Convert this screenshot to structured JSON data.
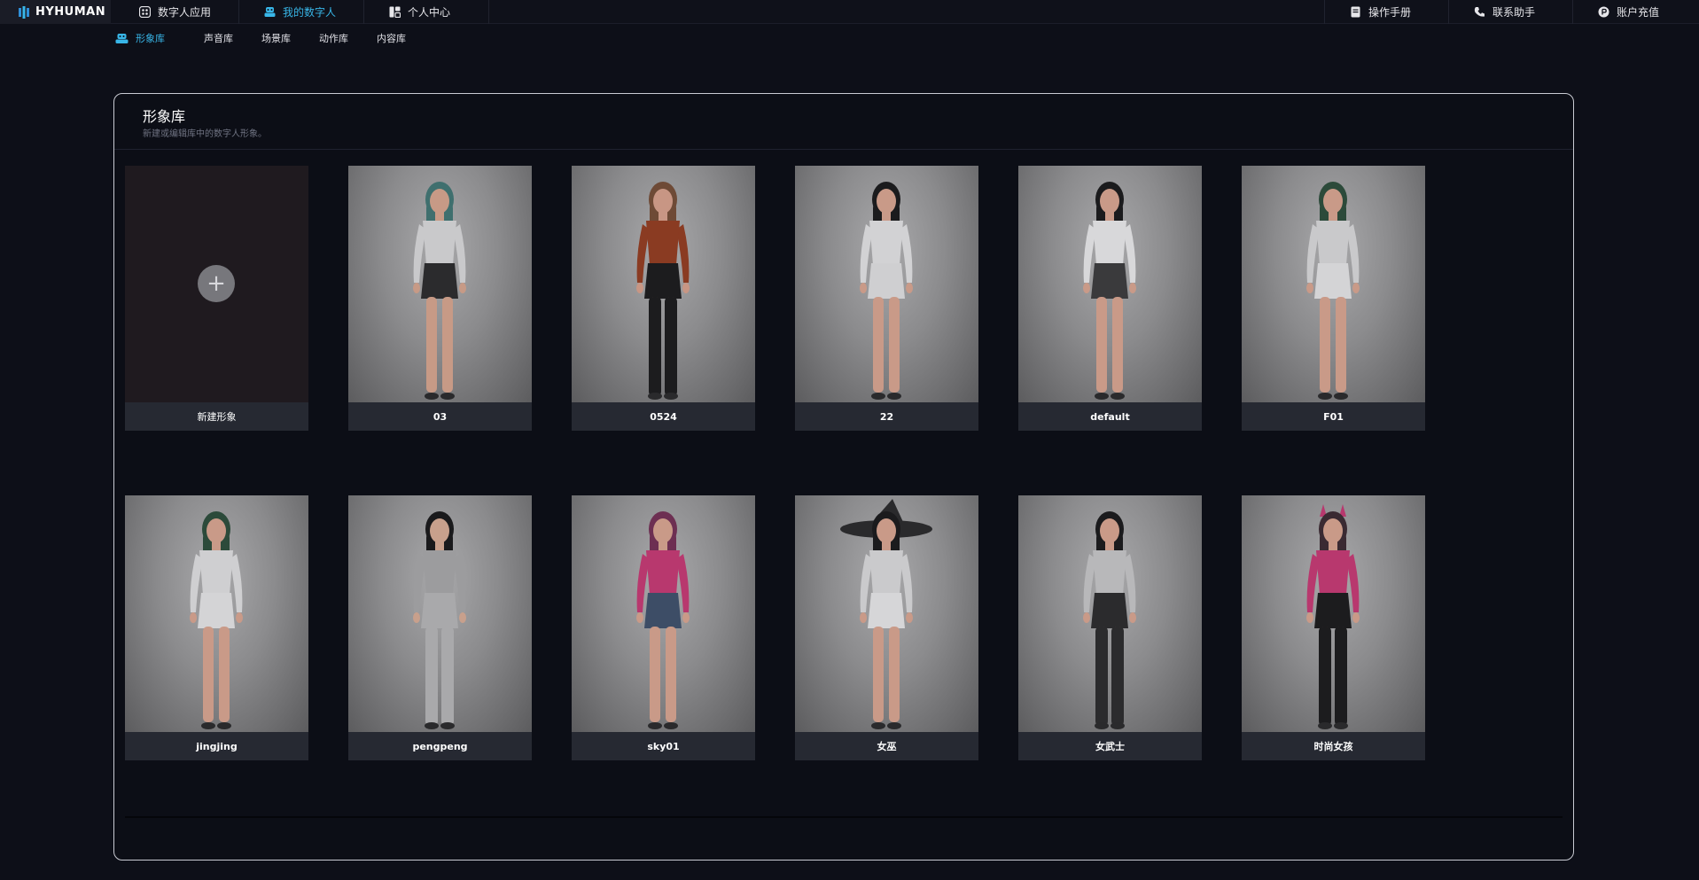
{
  "brand": {
    "name": "HYHUMAN"
  },
  "top_nav": {
    "left": [
      {
        "label": "数字人应用",
        "icon": "apps-icon"
      },
      {
        "label": "我的数字人",
        "icon": "avatar-icon",
        "active": true
      },
      {
        "label": "个人中心",
        "icon": "user-center-icon"
      }
    ],
    "right": [
      {
        "label": "操作手册",
        "icon": "manual-icon"
      },
      {
        "label": "联系助手",
        "icon": "phone-icon"
      },
      {
        "label": "账户充值",
        "icon": "recharge-icon"
      }
    ]
  },
  "sub_nav": [
    {
      "label": "形象库",
      "active": true,
      "icon": "avatar-library-icon"
    },
    {
      "label": "声音库"
    },
    {
      "label": "场景库"
    },
    {
      "label": "动作库"
    },
    {
      "label": "内容库"
    }
  ],
  "panel": {
    "title": "形象库",
    "subtitle": "新建或编辑库中的数字人形象。"
  },
  "cards": [
    {
      "label": "新建形象",
      "type": "new"
    },
    {
      "label": "03",
      "hair": "#3f6f6e",
      "top": "#c9c9cb",
      "bottom": "#2b2b2d",
      "skin": "#c79a86"
    },
    {
      "label": "0524",
      "hair": "#6e4a36",
      "top": "#8a3b22",
      "bottom": "#1c1c1e",
      "skin": "#c89684"
    },
    {
      "label": "22",
      "hair": "#1b1b1d",
      "top": "#d2d2d4",
      "bottom": "#cfcfd1",
      "skin": "#c99a88"
    },
    {
      "label": "default",
      "hair": "#1b1b1d",
      "top": "#d8d8da",
      "bottom": "#3a3a3c",
      "skin": "#c99a88"
    },
    {
      "label": "F01",
      "hair": "#2c4a3a",
      "top": "#c9c9cb",
      "bottom": "#d4d4d6",
      "skin": "#c99a88"
    },
    {
      "label": "jingjing",
      "hair": "#2c4a3a",
      "top": "#cfcfd1",
      "bottom": "#d4d4d6",
      "skin": "#c99a88"
    },
    {
      "label": "pengpeng",
      "hair": "#1a1a1c",
      "top": "#9c9c9e",
      "bottom": "#a9a9ab",
      "skin": "#c8a08c"
    },
    {
      "label": "sky01",
      "hair": "#6d2f52",
      "top": "#b8386e",
      "bottom": "#3d4d66",
      "skin": "#c99a88"
    },
    {
      "label": "女巫",
      "hair": "#1b1b1d",
      "top": "#cacacc",
      "bottom": "#d6d6d8",
      "skin": "#c99a88",
      "hat": true
    },
    {
      "label": "女武士",
      "hair": "#1b1b1d",
      "top": "#b8b8ba",
      "bottom": "#2b2b2d",
      "skin": "#c99a88"
    },
    {
      "label": "时尚女孩",
      "hair": "#3a2a32",
      "top": "#b8386e",
      "bottom": "#1c1c1e",
      "skin": "#c99a88",
      "horns": true
    }
  ]
}
